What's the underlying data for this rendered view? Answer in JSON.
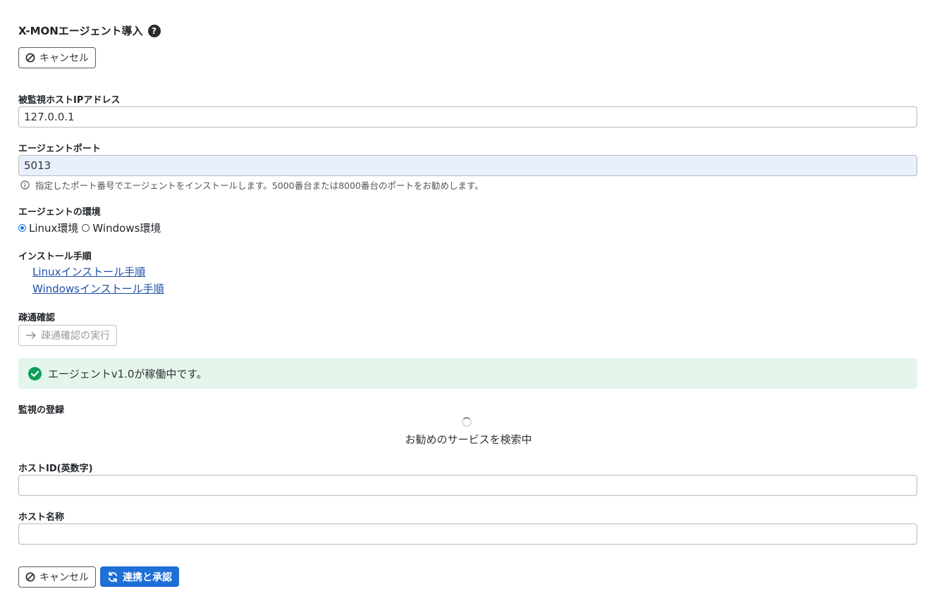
{
  "header": {
    "title": "X-MONエージェント導入",
    "help_icon": "question-circle-icon",
    "help_glyph": "?"
  },
  "top_cancel": {
    "label": "キャンセル",
    "icon": "ban-icon"
  },
  "host_ip": {
    "label": "被監視ホストIPアドレス",
    "value": "127.0.0.1"
  },
  "agent_port": {
    "label": "エージェントポート",
    "value": "5013",
    "hint": "指定したポート番号でエージェントをインストールします。5000番台または8000番台のポートをお勧めします。",
    "hint_icon": "info-icon"
  },
  "environment": {
    "label": "エージェントの環境",
    "options": [
      {
        "label": "Linux環境",
        "checked": true
      },
      {
        "label": "Windows環境",
        "checked": false
      }
    ]
  },
  "install": {
    "label": "インストール手順",
    "links": [
      "Linuxインストール手順",
      "Windowsインストール手順"
    ]
  },
  "connectivity": {
    "label": "疎通確認",
    "button_label": "疎通確認の実行",
    "button_icon": "arrow-right-icon"
  },
  "status": {
    "message": "エージェントv1.0が稼働中です。",
    "icon": "check-circle-icon",
    "color": "#0f9d58",
    "bg": "#e4f5ec"
  },
  "registration": {
    "label": "監視の登録",
    "loading_text": "お勧めのサービスを検索中"
  },
  "host_id": {
    "label": "ホストID(英数字)",
    "value": ""
  },
  "host_name": {
    "label": "ホスト名称",
    "value": ""
  },
  "footer": {
    "cancel_label": "キャンセル",
    "submit_label": "連携と承認",
    "submit_icon": "sync-icon",
    "accent": "#1e6fd6"
  }
}
